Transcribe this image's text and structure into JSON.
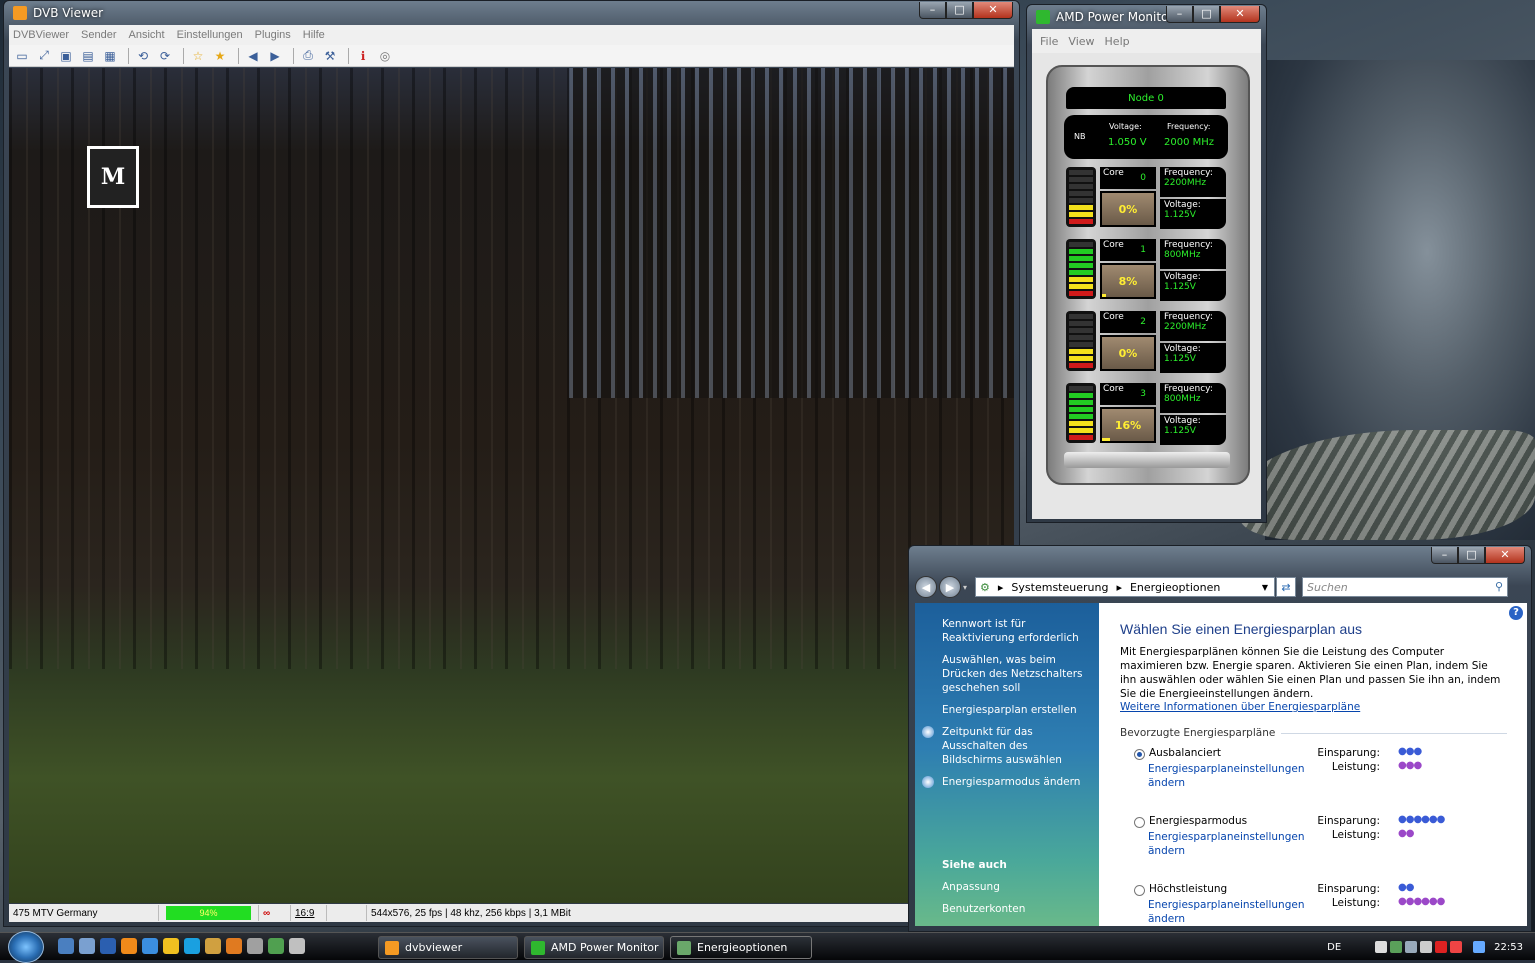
{
  "dvb": {
    "title": "DVB Viewer",
    "menu": [
      "DVBViewer",
      "Sender",
      "Ansicht",
      "Einstellungen",
      "Plugins",
      "Hilfe"
    ],
    "logo_text": "M",
    "status": {
      "channel": "475 MTV Germany",
      "signal": "94%",
      "signal_level": 0.94,
      "aspect": "16:9",
      "stream_info": "544x576, 25 fps | 48 khz, 256 kbps | 3,1 MBit"
    }
  },
  "amd": {
    "title": "AMD Power Monitor",
    "menu": [
      "File",
      "View",
      "Help"
    ],
    "node": "Node 0",
    "nb": {
      "label": "NB",
      "voltage_label": "Voltage:",
      "voltage": "1.050 V",
      "frequency_label": "Frequency:",
      "frequency": "2000 MHz"
    },
    "core_label": "Core",
    "freq_label": "Frequency:",
    "volt_label": "Voltage:",
    "cores": [
      {
        "num": "0",
        "load": "0%",
        "frequency": "2200MHz",
        "voltage": "1.125V"
      },
      {
        "num": "1",
        "load": "8%",
        "frequency": "800MHz",
        "voltage": "1.125V"
      },
      {
        "num": "2",
        "load": "0%",
        "frequency": "2200MHz",
        "voltage": "1.125V"
      },
      {
        "num": "3",
        "load": "16%",
        "frequency": "800MHz",
        "voltage": "1.125V"
      }
    ]
  },
  "energy": {
    "breadcrumb": [
      "Systemsteuerung",
      "Energieoptionen"
    ],
    "search_placeholder": "Suchen",
    "sidebar": {
      "links": [
        "Kennwort ist für Reaktivierung erforderlich",
        "Auswählen, was beim Drücken des Netzschalters geschehen soll",
        "Energiesparplan erstellen",
        "Zeitpunkt für das Ausschalten des Bildschirms auswählen",
        "Energiesparmodus ändern"
      ],
      "see_also": "Siehe auch",
      "see_also_links": [
        "Anpassung",
        "Benutzerkonten"
      ]
    },
    "heading": "Wählen Sie einen Energiesparplan aus",
    "description": "Mit Energiesparplänen können Sie die Leistung des Computer maximieren bzw. Energie sparen. Aktivieren Sie einen Plan, indem Sie ihn auswählen oder wählen Sie einen Plan und passen Sie ihn an, indem Sie die Energieeinstellungen ändern.",
    "more_info": "Weitere Informationen über Energiesparpläne",
    "group_label": "Bevorzugte Energiesparpläne",
    "saving_label": "Einsparung:",
    "perf_label": "Leistung:",
    "edit_link": "Energiesparplaneinstellungen ändern",
    "plans": [
      {
        "name": "Ausbalanciert",
        "selected": true,
        "saving": "●●●",
        "performance": "●●●"
      },
      {
        "name": "Energiesparmodus",
        "selected": false,
        "saving": "●●●●●●",
        "performance": "●●"
      },
      {
        "name": "Höchstleistung",
        "selected": false,
        "saving": "●●",
        "performance": "●●●●●●"
      }
    ]
  },
  "taskbar": {
    "tasks": [
      "dvbviewer",
      "AMD Power Monitor",
      "Energieoptionen"
    ],
    "lang": "DE",
    "clock": "22:53"
  }
}
